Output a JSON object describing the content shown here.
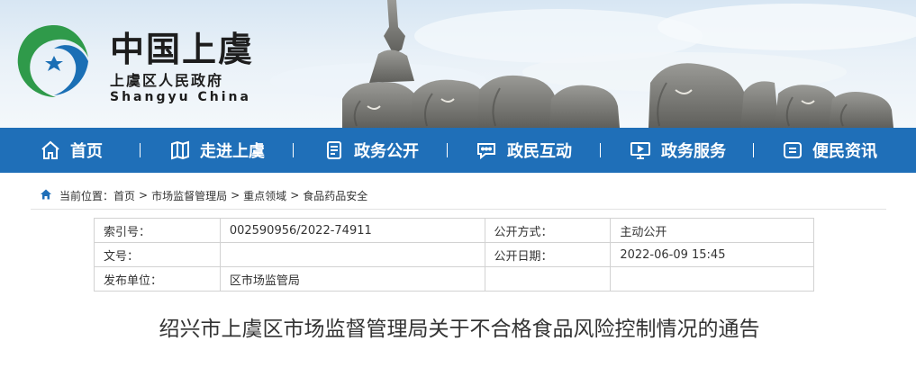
{
  "header": {
    "title": "中国上虞",
    "subtitle": "上虞区人民政府",
    "subtitle_en": "Shangyu China"
  },
  "nav": {
    "items": [
      {
        "label": "首页",
        "icon": "home-icon"
      },
      {
        "label": "走进上虞",
        "icon": "map-icon"
      },
      {
        "label": "政务公开",
        "icon": "document-icon"
      },
      {
        "label": "政民互动",
        "icon": "chat-icon"
      },
      {
        "label": "政务服务",
        "icon": "monitor-icon"
      },
      {
        "label": "便民资讯",
        "icon": "info-icon"
      }
    ]
  },
  "breadcrumb": {
    "prefix": "当前位置：",
    "items": [
      "首页",
      "市场监督管理局",
      "重点领域",
      "食品药品安全"
    ]
  },
  "info": {
    "index_label": "索引号：",
    "index_value": "002590956/2022-74911",
    "method_label": "公开方式：",
    "method_value": "主动公开",
    "docno_label": "文号：",
    "docno_value": "",
    "date_label": "公开日期：",
    "date_value": "2022-06-09 15:45",
    "publisher_label": "发布单位：",
    "publisher_value": "区市场监管局"
  },
  "document": {
    "title": "绍兴市上虞区市场监督管理局关于不合格食品风险控制情况的通告"
  },
  "colors": {
    "nav_bg": "#1f6fb8",
    "logo_green": "#2f9a4a",
    "logo_blue": "#1a6fb5"
  }
}
